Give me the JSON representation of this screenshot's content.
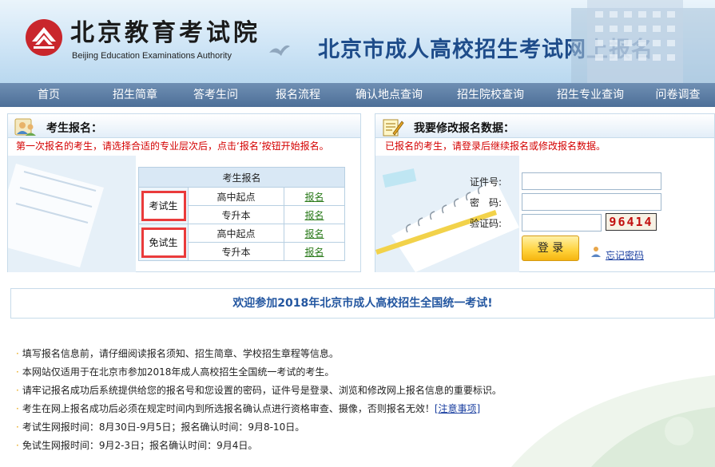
{
  "header": {
    "logo_cn": "北京教育考试院",
    "logo_en": "Beijing Education Examinations Authority",
    "site_title": "北京市成人高校招生考试网上报名"
  },
  "nav": [
    {
      "label": "首页",
      "w": 122
    },
    {
      "label": "招生简章",
      "w": 94
    },
    {
      "label": "答考生问",
      "w": 108
    },
    {
      "label": "报名流程",
      "w": 98
    },
    {
      "label": "确认地点查询",
      "w": 130
    },
    {
      "label": "招生院校查询",
      "w": 124
    },
    {
      "label": "招生专业查询",
      "w": 126
    },
    {
      "label": "问卷调查",
      "w": 93
    }
  ],
  "left_panel": {
    "title": "考生报名：",
    "notice": "第一次报名的考生，请选择合适的专业层次后，点击‘报名’按钮开始报名。",
    "table_header": "考生报名",
    "groups": [
      {
        "type": "考试生",
        "rows": [
          {
            "level": "高中起点",
            "action": "报名"
          },
          {
            "level": "专升本",
            "action": "报名"
          }
        ]
      },
      {
        "type": "免试生",
        "rows": [
          {
            "level": "高中起点",
            "action": "报名"
          },
          {
            "level": "专升本",
            "action": "报名"
          }
        ]
      }
    ]
  },
  "right_panel": {
    "title": "我要修改报名数据：",
    "notice": "已报名的考生，请登录后继续报名或修改报名数据。",
    "id_label": "证件号:",
    "pwd_label": "密　码:",
    "captcha_label": "验证码:",
    "id_value": "",
    "pwd_value": "",
    "captcha_value": "",
    "captcha_code": "96414",
    "login_label": "登 录",
    "forgot_label": "忘记密码"
  },
  "welcome": "欢迎参加2018年北京市成人高校招生全国统一考试!",
  "notices": [
    {
      "text": "填写报名信息前，请仔细阅读报名须知、招生简章、学校招生章程等信息。"
    },
    {
      "text": "本网站仅适用于在北京市参加2018年成人高校招生全国统一考试的考生。"
    },
    {
      "text": "请牢记报名成功后系统提供给您的报名号和您设置的密码，证件号是登录、浏览和修改网上报名信息的重要标识。"
    },
    {
      "text": "考生在网上报名成功后必须在规定时间内到所选报名确认点进行资格审查、摄像，否则报名无效！",
      "link": "[注意事项]"
    },
    {
      "text": "考试生网报时间：8月30日-9月5日；报名确认时间：9月8-10日。"
    },
    {
      "text": "免试生网报时间：9月2-3日；报名确认时间：9月4日。"
    }
  ],
  "colors": {
    "nav_bg": "#5a7ca5",
    "title_blue": "#1e4c8a",
    "notice_red": "#d40000",
    "highlight_red": "#ea3b3b",
    "link_green": "#2a7a1a",
    "link_blue": "#1a3fa0"
  }
}
